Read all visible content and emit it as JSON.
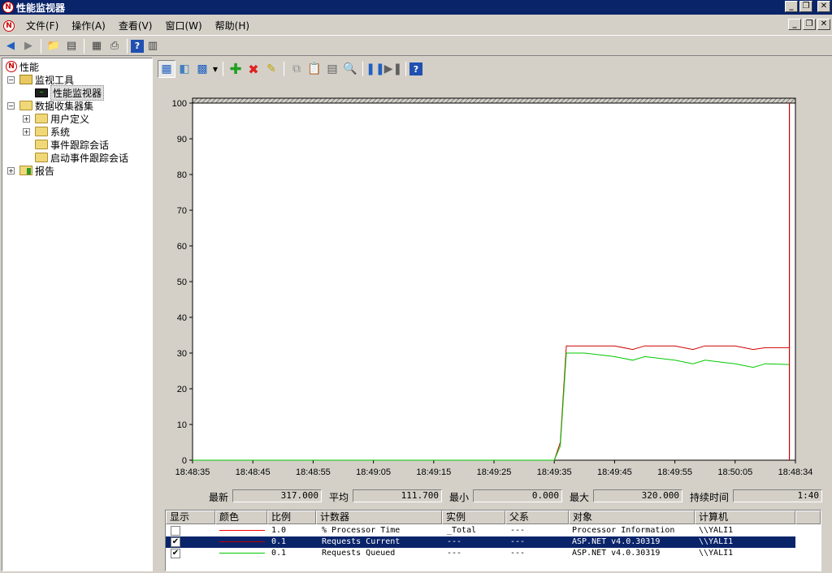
{
  "window": {
    "title": "性能监视器"
  },
  "menu": {
    "items": [
      "文件(F)",
      "操作(A)",
      "查看(V)",
      "窗口(W)",
      "帮助(H)"
    ]
  },
  "tree": {
    "root": "性能",
    "monitoring_tools": "监视工具",
    "perf_monitor": "性能监视器",
    "data_collector_sets": "数据收集器集",
    "user_defined": "用户定义",
    "system": "系统",
    "event_trace": "事件跟踪会话",
    "startup_event_trace": "启动事件跟踪会话",
    "reports": "报告"
  },
  "stats": {
    "latest_label": "最新",
    "latest_value": "317.000",
    "average_label": "平均",
    "average_value": "111.700",
    "min_label": "最小",
    "min_value": "0.000",
    "max_label": "最大",
    "max_value": "320.000",
    "duration_label": "持续时间",
    "duration_value": "1:40"
  },
  "legend": {
    "headers": {
      "show": "显示",
      "color": "颜色",
      "scale": "比例",
      "counter": "计数器",
      "instance": "实例",
      "parent": "父系",
      "object": "对象",
      "computer": "计算机"
    },
    "rows": [
      {
        "checked": false,
        "color": "#ff0000",
        "scale": "1.0",
        "counter": "% Processor Time",
        "instance": "_Total",
        "parent": "---",
        "object": "Processor Information",
        "computer": "\\\\YALI1"
      },
      {
        "checked": true,
        "color": "#c00000",
        "scale": "0.1",
        "counter": "Requests Current",
        "instance": "---",
        "parent": "---",
        "object": "ASP.NET v4.0.30319",
        "computer": "\\\\YALI1"
      },
      {
        "checked": true,
        "color": "#00c800",
        "scale": "0.1",
        "counter": "Requests Queued",
        "instance": "---",
        "parent": "---",
        "object": "ASP.NET v4.0.30319",
        "computer": "\\\\YALI1"
      }
    ]
  },
  "chart_data": {
    "type": "line",
    "ylim": [
      0,
      100
    ],
    "yticks": [
      0,
      10,
      20,
      30,
      40,
      50,
      60,
      70,
      80,
      90,
      100
    ],
    "xticks": [
      "18:48:35",
      "18:48:45",
      "18:48:55",
      "18:49:05",
      "18:49:15",
      "18:49:25",
      "18:49:35",
      "18:49:45",
      "18:49:55",
      "18:50:05",
      "18:48:34"
    ],
    "x": [
      0,
      1,
      2,
      3,
      4,
      5,
      6,
      7,
      8,
      9,
      10
    ],
    "series": [
      {
        "color": "#d00000",
        "x": [
          0,
          6,
          6.1,
          6.2,
          6.5,
          7,
          7.3,
          7.5,
          8,
          8.3,
          8.5,
          9,
          9.3,
          9.5,
          9.9
        ],
        "values": [
          0,
          0,
          5,
          32,
          32,
          32,
          31,
          32,
          32,
          31,
          32,
          32,
          31,
          31.5,
          31.5
        ]
      },
      {
        "color": "#00c800",
        "x": [
          0,
          6,
          6.1,
          6.2,
          6.5,
          7,
          7.3,
          7.5,
          8,
          8.3,
          8.5,
          9,
          9.3,
          9.5,
          9.9
        ],
        "values": [
          0,
          0,
          4,
          30,
          30,
          29,
          28,
          29,
          28,
          27,
          28,
          27,
          26,
          27,
          26.8
        ]
      }
    ],
    "cursor_line": {
      "x": 9.9,
      "color": "#d00000"
    }
  }
}
